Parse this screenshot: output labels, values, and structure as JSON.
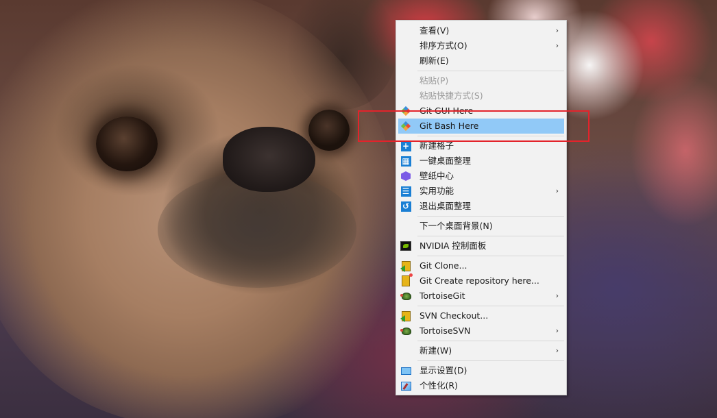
{
  "context_menu": {
    "items": [
      {
        "label": "查看(V)",
        "icon": "none",
        "submenu": true
      },
      {
        "label": "排序方式(O)",
        "icon": "none",
        "submenu": true
      },
      {
        "label": "刷新(E)",
        "icon": "none",
        "submenu": false
      },
      {
        "label": "粘贴(P)",
        "icon": "none",
        "disabled": true
      },
      {
        "label": "粘贴快捷方式(S)",
        "icon": "none",
        "disabled": true
      },
      {
        "label": "Git GUI Here",
        "icon": "git-gui-icon"
      },
      {
        "label": "Git Bash Here",
        "icon": "git-bash-icon",
        "highlighted": true
      },
      {
        "label": "新建格子",
        "icon": "new-grid-icon"
      },
      {
        "label": "一键桌面整理",
        "icon": "desktop-organize-icon"
      },
      {
        "label": "壁纸中心",
        "icon": "wallpaper-center-icon"
      },
      {
        "label": "实用功能",
        "icon": "utilities-icon",
        "submenu": true
      },
      {
        "label": "退出桌面整理",
        "icon": "exit-organize-icon"
      },
      {
        "label": "下一个桌面背景(N)",
        "icon": "none"
      },
      {
        "label": "NVIDIA 控制面板",
        "icon": "nvidia-icon"
      },
      {
        "label": "Git Clone...",
        "icon": "tortoisegit-clone-icon"
      },
      {
        "label": "Git Create repository here...",
        "icon": "tortoisegit-create-icon"
      },
      {
        "label": "TortoiseGit",
        "icon": "tortoisegit-icon",
        "submenu": true
      },
      {
        "label": "SVN Checkout...",
        "icon": "svn-checkout-icon"
      },
      {
        "label": "TortoiseSVN",
        "icon": "tortoisesvn-icon",
        "submenu": true
      },
      {
        "label": "新建(W)",
        "icon": "none",
        "submenu": true
      },
      {
        "label": "显示设置(D)",
        "icon": "display-settings-icon"
      },
      {
        "label": "个性化(R)",
        "icon": "personalize-icon"
      }
    ],
    "submenu_arrow": "›"
  },
  "icon_glyphs": {
    "new_grid": "+",
    "desktop_organize": "▦",
    "utilities": "☰",
    "exit_organize": "↺"
  },
  "colors": {
    "highlight": "#91c9f7",
    "annotation_box": "#e3232b",
    "menu_bg": "#f2f2f2",
    "disabled_text": "#9b9b9b"
  }
}
